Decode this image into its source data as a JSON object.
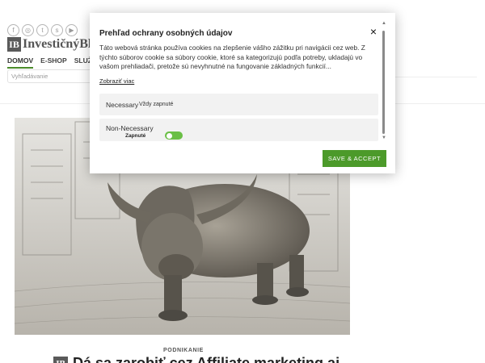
{
  "site": {
    "brand_mark": "IB",
    "brand_name": "InvestičnýBl",
    "social_icons": [
      "facebook-icon",
      "instagram-icon",
      "twitter-icon",
      "skype-icon",
      "youtube-icon"
    ],
    "social_glyphs": [
      "f",
      "◎",
      "t",
      "s",
      "▶"
    ],
    "nav": [
      {
        "label": "DOMOV",
        "active": true
      },
      {
        "label": "E-SHOP",
        "active": false
      },
      {
        "label": "SLUŽ",
        "active": false
      }
    ],
    "search_placeholder": "Vyhľadávanie"
  },
  "article": {
    "category": "PODNIKANIE",
    "title_mark": "IB",
    "title": "Dá sa zarobiť cez Affiliate marketing aj"
  },
  "cookie_modal": {
    "title": "Prehľad ochrany osobných údajov",
    "close_glyph": "×",
    "description": "Táto webová stránka používa cookies na zlepšenie vášho zážitku pri navigácii cez web. Z týchto súborov cookie sa súbory cookie, ktoré sa kategorizujú podľa potreby, ukladajú vo vašom prehliadači, pretože sú nevyhnutné na fungovanie základných funkcií...",
    "show_more": "Zobraziť viac",
    "categories": [
      {
        "name": "Necessary",
        "status": "Vždy zapnuté"
      },
      {
        "name": "Non-Necessary",
        "toggle_label": "Zapnuté",
        "enabled": true
      }
    ],
    "save_button": "SAVE & ACCEPT"
  },
  "colors": {
    "accent_green": "#4c9a2a",
    "toggle_green": "#6abf45"
  }
}
